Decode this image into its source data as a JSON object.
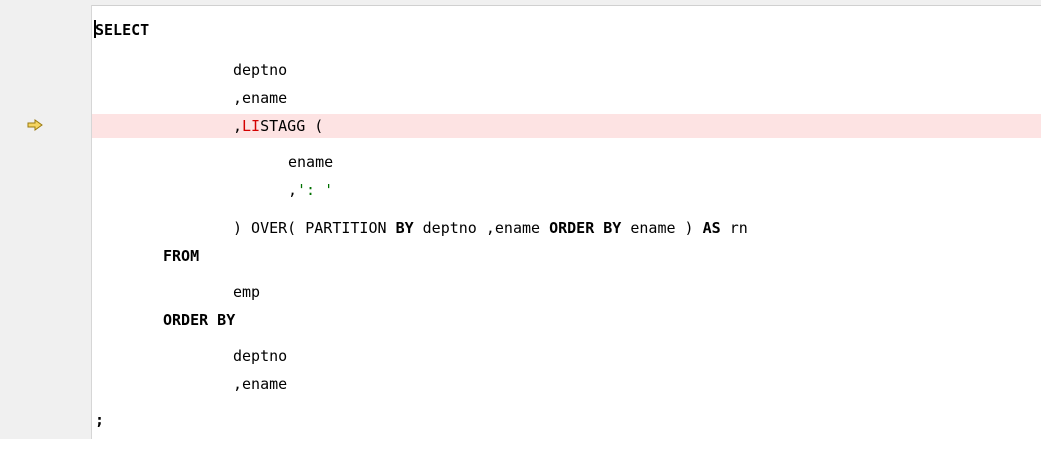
{
  "editor": {
    "lines": {
      "l1": {
        "kw": "SELECT"
      },
      "l2": {
        "text": "deptno"
      },
      "l3": {
        "text": ",ename"
      },
      "l4": {
        "pre": ",",
        "fn": "LI",
        "post": "STAGG ("
      },
      "l5": {
        "text": "ename"
      },
      "l6": {
        "pre": ",",
        "str": "': '"
      },
      "l7": {
        "a": ") OVER( PARTITION ",
        "k1": "BY",
        "b": " deptno ,ename ",
        "k2": "ORDER BY",
        "c": " ename ) ",
        "k3": "AS",
        "d": " rn"
      },
      "l8": {
        "kw": "FROM"
      },
      "l9": {
        "text": "emp"
      },
      "l10": {
        "kw": "ORDER BY"
      },
      "l11": {
        "text": "deptno"
      },
      "l12": {
        "text": ",ename"
      },
      "l13": {
        "text": ";"
      }
    },
    "current_line_marker": "arrow-right-icon",
    "colors": {
      "highlight": "#fde3e3",
      "function": "#d40000",
      "string": "#007000",
      "arrow": "#f5d562"
    }
  }
}
